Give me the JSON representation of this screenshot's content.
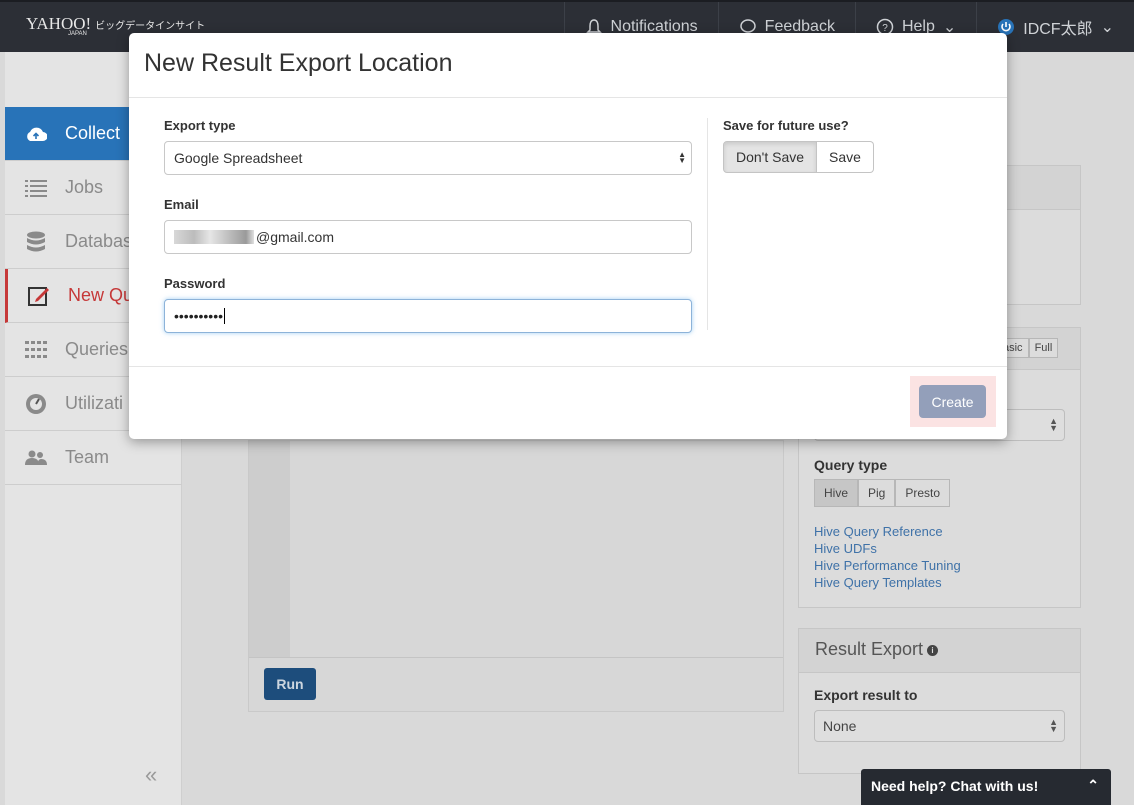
{
  "topbar": {
    "logo": "YAHOO!",
    "logo_sub": "ビッグデータインサイト",
    "logo_jp": "JAPAN",
    "notifications": "Notifications",
    "feedback": "Feedback",
    "help": "Help",
    "user": "IDCF太郎"
  },
  "sidebar": {
    "items": [
      {
        "label": "Collect",
        "icon": "cloud-upload-icon"
      },
      {
        "label": "Jobs",
        "icon": "list-icon"
      },
      {
        "label": "Databas",
        "icon": "database-icon"
      },
      {
        "label": "New Qu",
        "icon": "edit-icon"
      },
      {
        "label": "Queries",
        "icon": "grid-icon"
      },
      {
        "label": "Utilizati",
        "icon": "gauge-icon"
      },
      {
        "label": "Team",
        "icon": "users-icon"
      }
    ],
    "collapse": "«"
  },
  "editor": {
    "run_label": "Run"
  },
  "right_panel": {
    "mode_basic": "asic",
    "mode_full": "Full",
    "query_type_label": "Query type",
    "query_types": [
      "Hive",
      "Pig",
      "Presto"
    ],
    "links": [
      "Hive Query Reference",
      "Hive UDFs",
      "Hive Performance Tuning",
      "Hive Query Templates"
    ]
  },
  "result_export": {
    "title": "Result Export",
    "export_label": "Export result to",
    "export_value": "None"
  },
  "chat": {
    "label": "Need help? Chat with us!"
  },
  "modal": {
    "title": "New Result Export Location",
    "export_type_label": "Export type",
    "export_type_value": "Google Spreadsheet",
    "email_label": "Email",
    "email_value": "@gmail.com",
    "password_label": "Password",
    "password_value": "••••••••••",
    "save_label": "Save for future use?",
    "dont_save": "Don't Save",
    "save": "Save",
    "create": "Create"
  },
  "colors": {
    "primary": "#2873b8",
    "create_button": "#939fba",
    "topbar": "#2c2f36",
    "active_red": "#c63838"
  }
}
